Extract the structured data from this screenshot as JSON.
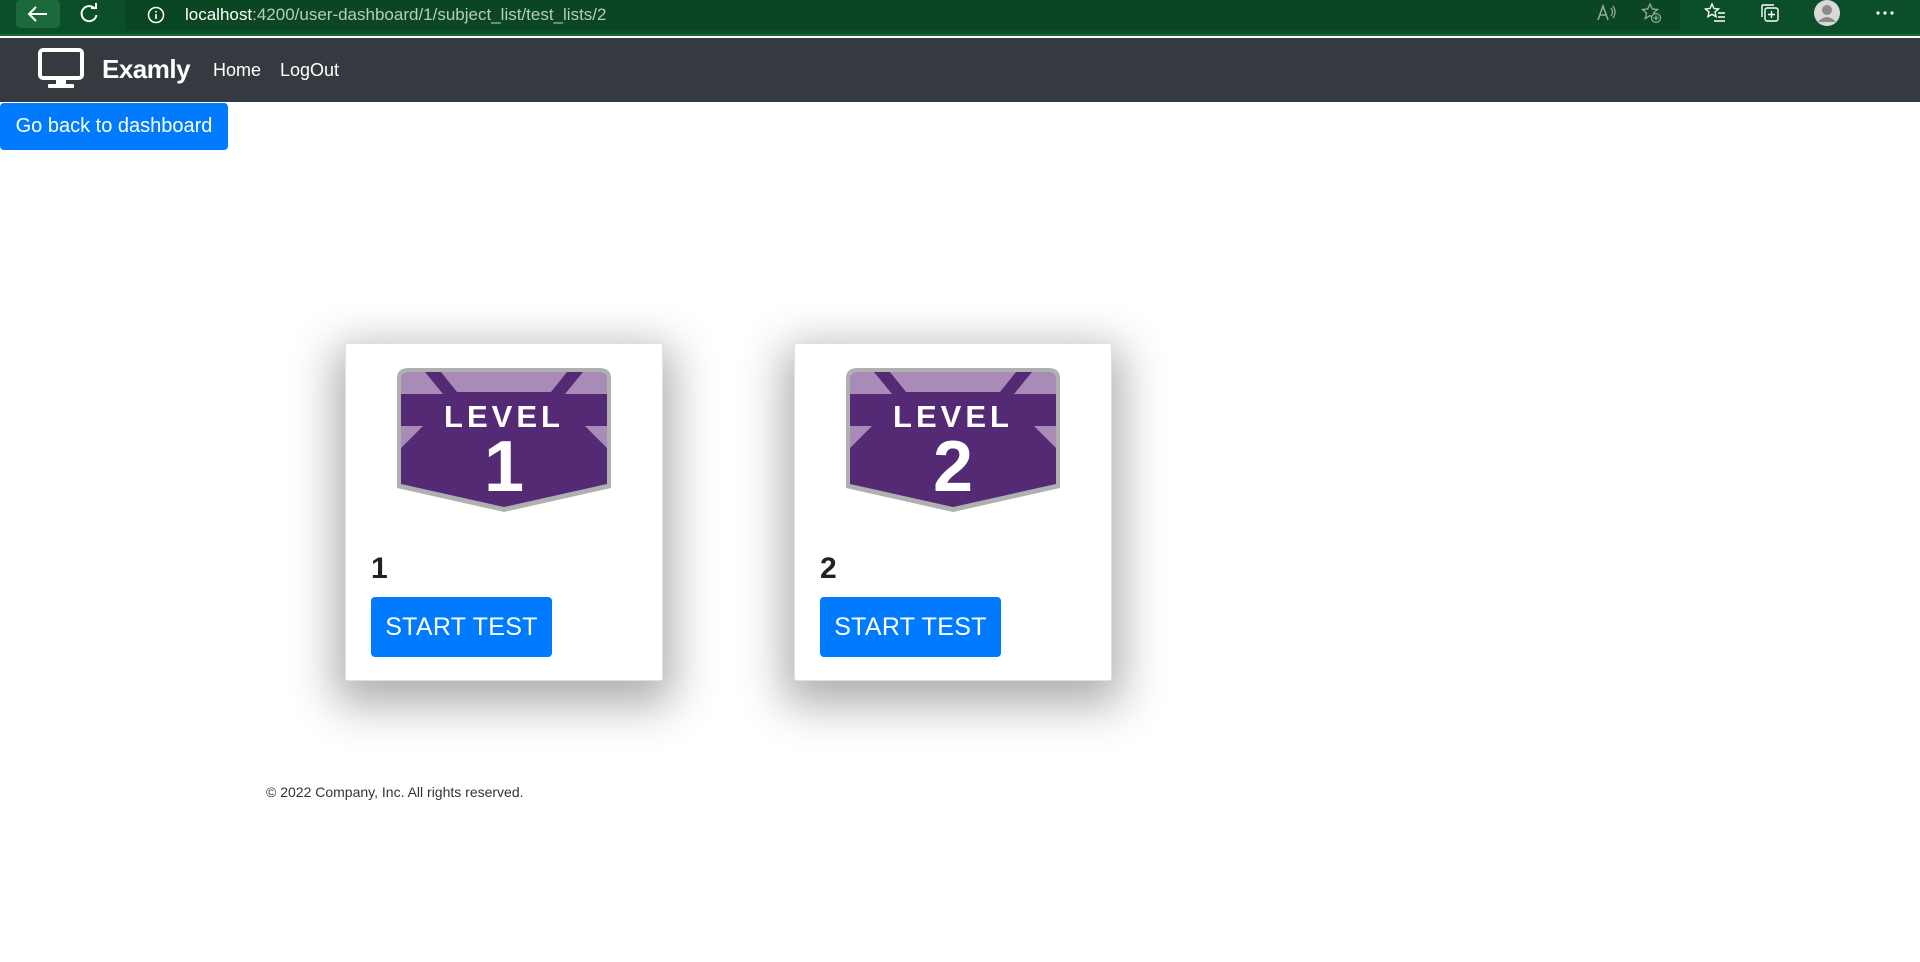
{
  "browser": {
    "url_host": "localhost",
    "url_path": ":4200/user-dashboard/1/subject_list/test_lists/2"
  },
  "navbar": {
    "brand": "Examly",
    "links": [
      "Home",
      "LogOut"
    ]
  },
  "back_button": "Go back to dashboard",
  "cards": [
    {
      "badge_top": "LEVEL",
      "badge_num": "1",
      "title": "1",
      "button": "START TEST"
    },
    {
      "badge_top": "LEVEL",
      "badge_num": "2",
      "title": "2",
      "button": "START TEST"
    }
  ],
  "footer": "© 2022 Company, Inc. All rights reserved.",
  "colors": {
    "primary": "#007bff",
    "navbar": "#343a40",
    "badge_purple": "#532a73",
    "badge_light": "#a98bb8"
  }
}
